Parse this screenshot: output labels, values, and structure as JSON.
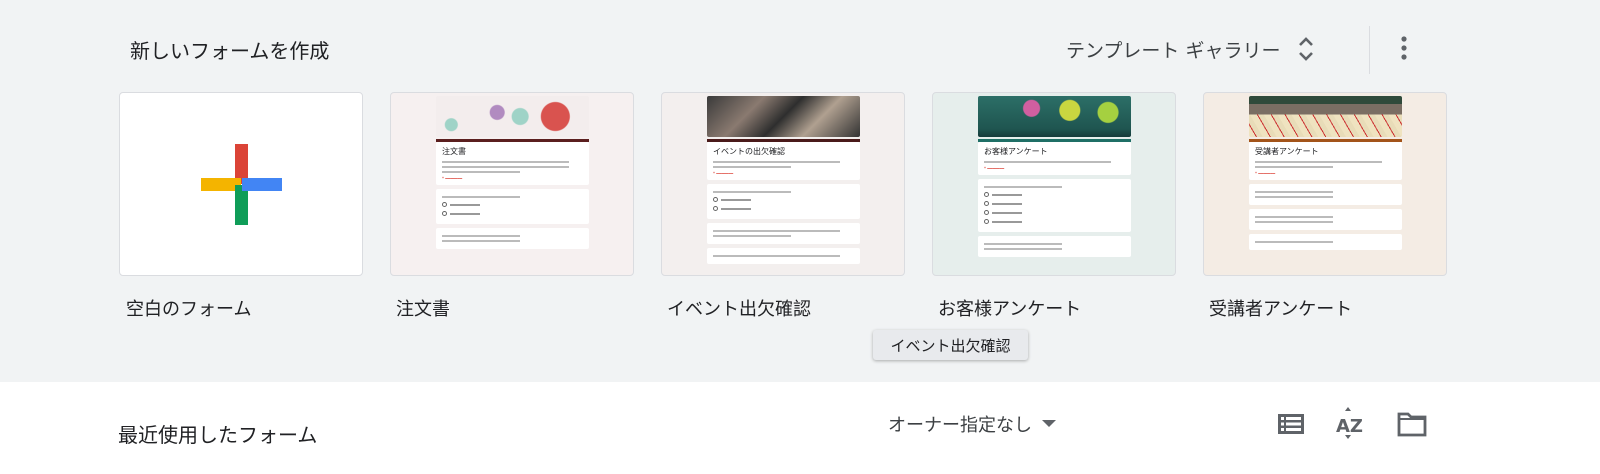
{
  "header": {
    "title": "新しいフォームを作成",
    "gallery_label": "テンプレート ギャラリー"
  },
  "templates": [
    {
      "label": "空白のフォーム"
    },
    {
      "label": "注文書",
      "form_title": "注文書",
      "accent": "#5b1f1f",
      "bg": "#f6f0f0"
    },
    {
      "label": "イベント出欠確認",
      "form_title": "イベントの出欠確認",
      "accent": "#4a1a1a",
      "bg": "#f3efee"
    },
    {
      "label": "お客様アンケート",
      "form_title": "お客様アンケート",
      "accent": "#1f6f66",
      "bg": "#e6eeec"
    },
    {
      "label": "受講者アンケート",
      "form_title": "受講者アンケート",
      "accent": "#a3541a",
      "bg": "#f4ece4"
    }
  ],
  "tooltip": "イベント出欠確認",
  "recent": {
    "title": "最近使用したフォーム",
    "owner_filter": "オーナー指定なし"
  },
  "icons": [
    "unfold-icon",
    "more-vert-icon",
    "list-view-icon",
    "sort-az-icon",
    "folder-icon"
  ]
}
